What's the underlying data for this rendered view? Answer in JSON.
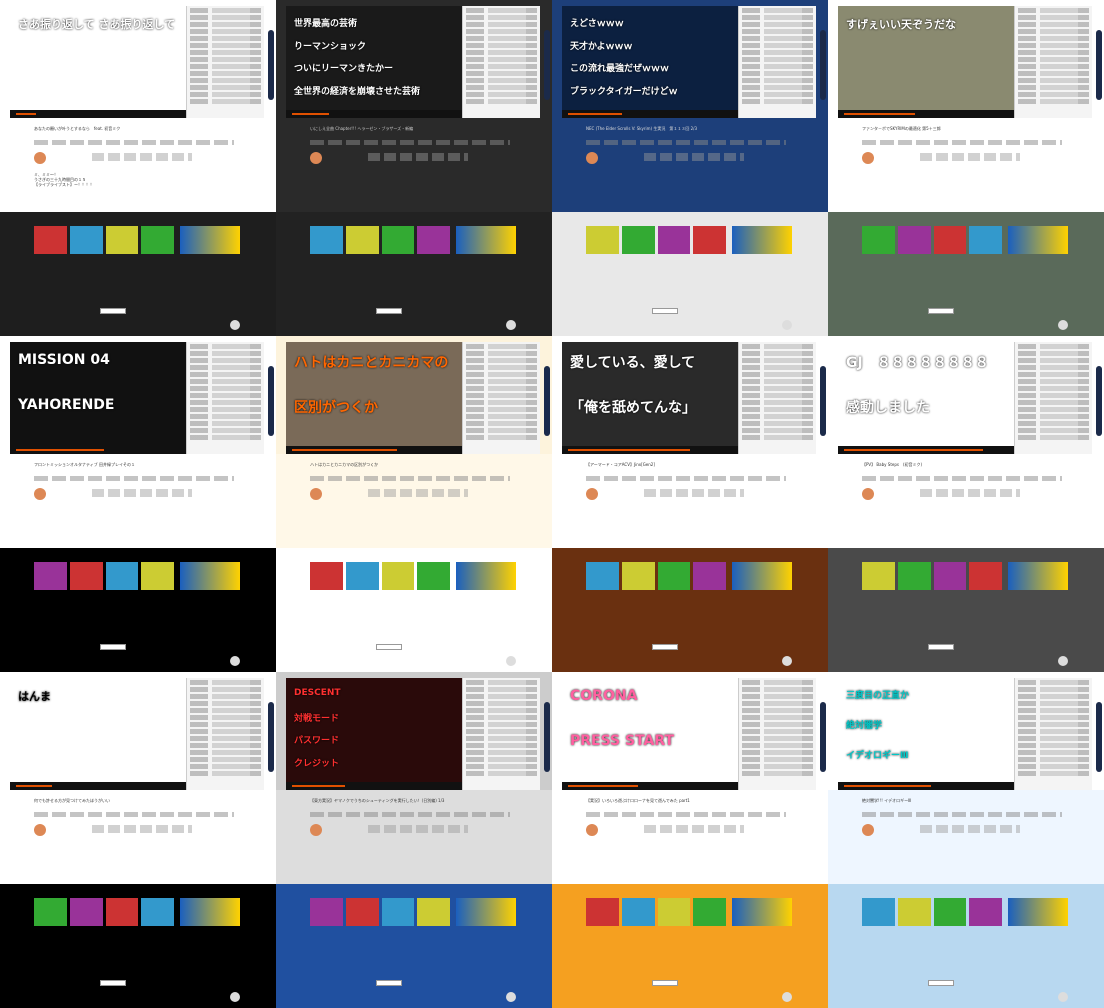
{
  "tiles": [
    {
      "title": "あなたの願いが叶うとするなら　feat. 初音ミク",
      "vlines": [
        "さあ振り返して さあ振り返して"
      ],
      "desc": "ミ、ミミ～！\nうさぎの三十九時間目の１５\n【ライブライブスト】ー！！！！",
      "colors": {
        "page": "#ffffff",
        "video": "#ffffff",
        "info": "#ffffff",
        "lower": "#1e1e1e",
        "vtext": "#ffffff",
        "text": "#333333"
      }
    },
    {
      "title": "いにしえ全曲 Chapter!!! ヘラーゼン・ブラザーズ・新編",
      "vlines": [
        "世界最高の芸術",
        "りーマンショック",
        "ついにリーマンきたかー",
        "全世界の経済を崩壊させた芸術"
      ],
      "desc": "",
      "colors": {
        "page": "#2a2a2a",
        "video": "#1a1a1a",
        "info": "#2a2a2a",
        "lower": "#222222",
        "vtext": "#ffffff",
        "text": "#cccccc"
      }
    },
    {
      "title": "NEC (The Elder Scrolls V: Skyrim) 生実況　第１１３回 2/3",
      "vlines": [
        "えどさｗｗｗ",
        "天才かよｗｗｗ",
        "この流れ最強だぜｗｗｗ",
        "ブラックタイガーだけどｗ"
      ],
      "desc": "",
      "colors": {
        "page": "#1d3f7a",
        "video": "#0c2040",
        "info": "#1d3f7a",
        "lower": "#e8e8e8",
        "vtext": "#ffffff",
        "text": "#dddddd"
      }
    },
    {
      "title": "ファンタ－ボでSKYRIMの最適化 第5＋三郎",
      "vlines": [
        "すげぇいい天ぞうだな"
      ],
      "desc": "",
      "colors": {
        "page": "#ffffff",
        "video": "#8a8a70",
        "info": "#ffffff",
        "lower": "#5a6a5a",
        "vtext": "#ffffff",
        "text": "#333333"
      }
    },
    {
      "title": "フロントミッションオルタナティブ 田井緑プレイその１",
      "vlines": [
        "MISSION 04",
        "YAHORENDE"
      ],
      "desc": "",
      "colors": {
        "page": "#ffffff",
        "video": "#111111",
        "info": "#ffffff",
        "lower": "#000000",
        "vtext": "#ffffff",
        "text": "#333333"
      }
    },
    {
      "title": "ハトはカニとカニカマの区別がつくか",
      "vlines": [
        "ハトはカニとカニカマの",
        "区別がつくか"
      ],
      "desc": "",
      "colors": {
        "page": "#fdf3dc",
        "video": "#7a6a58",
        "info": "#fff8e8",
        "lower": "#ffffff",
        "vtext": "#ff6600",
        "text": "#333333"
      }
    },
    {
      "title": "【アーマード・コアACV】Jinx[Gen2]",
      "vlines": [
        "愛している、愛して",
        "「俺を舐めてんな」"
      ],
      "desc": "",
      "colors": {
        "page": "#ffffff",
        "video": "#2a2a2a",
        "info": "#ffffff",
        "lower": "#6a3010",
        "vtext": "#ffffff",
        "text": "#333333"
      }
    },
    {
      "title": "【PV】 Baby Steps　(初音ミク)",
      "vlines": [
        "GJ　８８８８８８８８",
        "感動しました"
      ],
      "desc": "",
      "colors": {
        "page": "#ffffff",
        "video": "#ffffff",
        "info": "#ffffff",
        "lower": "#4a4a4a",
        "vtext": "#ffffff",
        "text": "#333333"
      }
    },
    {
      "title": "何でも許せる方が見つけてみたほうがいい",
      "vlines": [
        "はんま"
      ],
      "desc": "",
      "colors": {
        "page": "#ffffff",
        "video": "#ffffff",
        "info": "#ffffff",
        "lower": "#000000",
        "vtext": "#000000",
        "text": "#333333"
      }
    },
    {
      "title": "【東方実況】ヤマノクでうちのシューティングを実行したい！(日別編) 1/3",
      "vlines": [
        "DESCENT",
        "対戦モード",
        "パスワード",
        "クレジット"
      ],
      "desc": "",
      "colors": {
        "page": "#cccccc",
        "video": "#2a0a0a",
        "info": "#dddddd",
        "lower": "#2050a0",
        "vtext": "#ff3030",
        "text": "#333333"
      }
    },
    {
      "title": "【実況】いろいろ遊ぶけロローナを見て遊んでみた part1",
      "vlines": [
        "CORONA",
        "PRESS START"
      ],
      "desc": "",
      "colors": {
        "page": "#ffffff",
        "video": "#ffffff",
        "info": "#ffffff",
        "lower": "#f5a020",
        "vtext": "#ff60a0",
        "text": "#333333"
      }
    },
    {
      "title": "絶対闇学!!! イデオロギーⅢ",
      "vlines": [
        "三度目の正直か",
        "絶対闇学",
        "イデオロギーⅢ"
      ],
      "desc": "",
      "colors": {
        "page": "#ffffff",
        "video": "#ffffff",
        "info": "#eef6ff",
        "lower": "#b8d8f0",
        "vtext": "#00c8c8",
        "text": "#333333"
      }
    }
  ]
}
